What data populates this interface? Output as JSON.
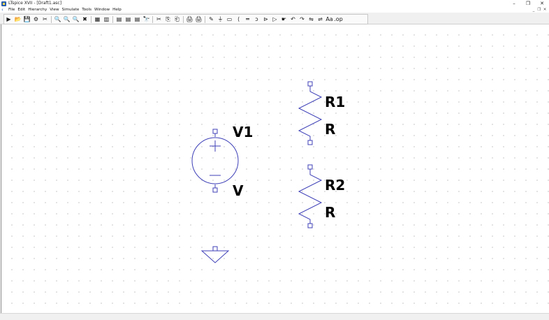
{
  "window": {
    "title": "LTspice XVII - [Draft1.asc]",
    "controls": [
      "–",
      "❐",
      "✕"
    ],
    "mdi_controls": [
      "_",
      "❐",
      "✕"
    ]
  },
  "menu": {
    "back_glyph": "‹",
    "items": [
      "File",
      "Edit",
      "Hierarchy",
      "View",
      "Simulate",
      "Tools",
      "Window",
      "Help"
    ]
  },
  "toolbar": {
    "groups": [
      [
        "▶",
        "📂",
        "💾",
        "⚙",
        "✂"
      ],
      [
        "🔍",
        "🔍",
        "🔍",
        "✖"
      ],
      [
        "▦",
        "▥"
      ],
      [
        "▤",
        "▤",
        "▤",
        "🔭"
      ],
      [
        "✂",
        "⎘",
        "⎗"
      ],
      [
        "🖨",
        "🖨"
      ],
      [
        "✎",
        "⏚",
        "▭",
        "⟨",
        "═",
        "ↄ",
        "⊳",
        "▷",
        "☛",
        "↶",
        "↷",
        "⇋",
        "⇌",
        "Aa",
        ".op"
      ]
    ]
  },
  "schematic": {
    "components": [
      {
        "ref": "V1",
        "value": "V",
        "type": "voltage-source"
      },
      {
        "ref": "R1",
        "value": "R",
        "type": "resistor"
      },
      {
        "ref": "R2",
        "value": "R",
        "type": "resistor"
      }
    ],
    "wire_color": "#3d3fb7",
    "pin_color": "#3d3fb7"
  }
}
